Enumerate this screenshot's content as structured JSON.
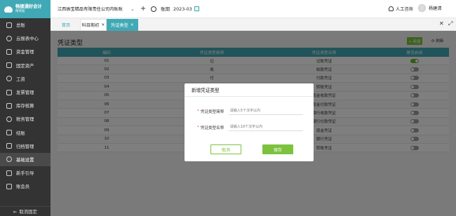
{
  "app": {
    "name": "畅捷通好会计",
    "sub": "精简版"
  },
  "sidebar": {
    "items": [
      {
        "label": "总账",
        "icon": "ledger-icon"
      },
      {
        "label": "云报表中心",
        "icon": "report-icon"
      },
      {
        "label": "资金管理",
        "icon": "fund-icon"
      },
      {
        "label": "固定资产",
        "icon": "asset-icon"
      },
      {
        "label": "工资",
        "icon": "salary-icon"
      },
      {
        "label": "发票管理",
        "icon": "invoice-icon"
      },
      {
        "label": "库存核算",
        "icon": "inventory-icon"
      },
      {
        "label": "税务管理",
        "icon": "tax-icon"
      },
      {
        "label": "结账",
        "icon": "closing-icon"
      },
      {
        "label": "归档管理",
        "icon": "archive-icon"
      },
      {
        "label": "基础设置",
        "icon": "settings-icon"
      },
      {
        "label": "新手引导",
        "icon": "guide-icon"
      },
      {
        "label": "账会员",
        "icon": "member-icon"
      }
    ],
    "active": "基础设置",
    "collapse_label": "取消固定"
  },
  "header": {
    "company": "江西振宝精品有限责任公司内账账",
    "period_label": "账期",
    "period_value": "2023-03",
    "support_label": "人工咨询",
    "user_name": "杨建清"
  },
  "tabs": [
    {
      "label": "首页"
    },
    {
      "label": "科目期初"
    },
    {
      "label": "凭证类型"
    }
  ],
  "page": {
    "title": "凭证类型",
    "add_label": "+ 新增",
    "refresh_label": "刷新",
    "columns": [
      "编码",
      "凭证类型简称",
      "凭证类型名称",
      "是否启用"
    ],
    "rows": [
      {
        "code": "01",
        "short": "记",
        "name": "记账凭证",
        "enabled": true
      },
      {
        "code": "02",
        "short": "收",
        "name": "收款凭证",
        "enabled": false
      },
      {
        "code": "03",
        "short": "付",
        "name": "付款凭证",
        "enabled": false
      },
      {
        "code": "04",
        "short": "转",
        "name": "转账凭证",
        "enabled": false
      },
      {
        "code": "05",
        "short": "现收",
        "name": "现金收款凭证",
        "enabled": false
      },
      {
        "code": "06",
        "short": "现付",
        "name": "现金付款凭证",
        "enabled": false
      },
      {
        "code": "07",
        "short": "银收",
        "name": "银行收款凭证",
        "enabled": false
      },
      {
        "code": "08",
        "short": "银付",
        "name": "银行付款凭证",
        "enabled": false
      },
      {
        "code": "09",
        "short": "现",
        "name": "现金凭证",
        "enabled": false
      },
      {
        "code": "10",
        "short": "银",
        "name": "银行凭证",
        "enabled": false
      },
      {
        "code": "11",
        "short": "转",
        "name": "转账凭证",
        "enabled": false
      }
    ]
  },
  "modal": {
    "title": "新增凭证类型",
    "field1_label": "凭证类型简称",
    "field1_placeholder": "请输入5个汉字以内",
    "field2_label": "凭证类型名称",
    "field2_placeholder": "请输入10个汉字以内",
    "cancel_label": "取消",
    "save_label": "保存"
  },
  "colors": {
    "accent": "#40a9b5",
    "green": "#7cc23f",
    "sidebar": "#333333"
  }
}
